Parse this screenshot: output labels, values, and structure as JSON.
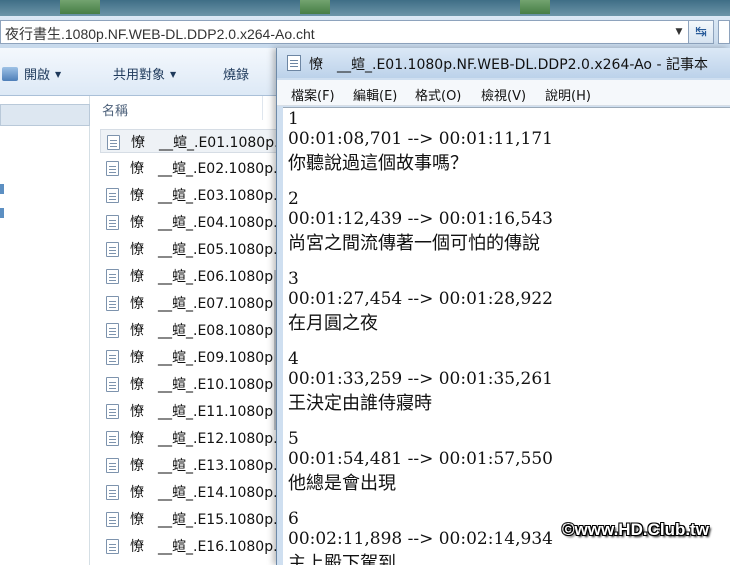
{
  "explorer": {
    "address": "夜行書生.1080p.NF.WEB-DL.DDP2.0.x264-Ao.cht",
    "toolbar": {
      "organize": "開啟",
      "share": "共用對象",
      "burn": "燒錄"
    },
    "column_header": "名稱",
    "files": [
      "憭　__蝖_.E01.1080p.",
      "憭　__蝖_.E02.1080p.",
      "憭　__蝖_.E03.1080p.",
      "憭　__蝖_.E04.1080p.",
      "憭　__蝖_.E05.1080p.",
      "憭　__蝖_.E06.1080p.",
      "憭　__蝖_.E07.1080p.",
      "憭　__蝖_.E08.1080p.",
      "憭　__蝖_.E09.1080p.",
      "憭　__蝖_.E10.1080p.",
      "憭　__蝖_.E11.1080p.",
      "憭　__蝖_.E12.1080p.",
      "憭　__蝖_.E13.1080p.",
      "憭　__蝖_.E14.1080p.",
      "憭　__蝖_.E15.1080p.",
      "憭　__蝖_.E16.1080p."
    ]
  },
  "notepad": {
    "title": "憭　__蝖_.E01.1080p.NF.WEB-DL.DDP2.0.x264-Ao - 記事本",
    "menu": [
      "檔案(F)",
      "編輯(E)",
      "格式(O)",
      "檢視(V)",
      "說明(H)"
    ],
    "lines": [
      "1",
      "00:01:08,701 --> 00:01:11,171",
      "你聽說過這個故事嗎？",
      "",
      "2",
      "00:01:12,439 --> 00:01:16,543",
      "尚宮之間流傳著一個可怕的傳說",
      "",
      "3",
      "00:01:27,454 --> 00:01:28,922",
      "在月圓之夜",
      "",
      "4",
      "00:01:33,259 --> 00:01:35,261",
      "王決定由誰侍寢時",
      "",
      "5",
      "00:01:54,481 --> 00:01:57,550",
      "他總是會出現",
      "",
      "6",
      "00:02:11,898 --> 00:02:14,934",
      "主上殿下駕到"
    ]
  },
  "watermark": "©www.HD.Club.tw"
}
